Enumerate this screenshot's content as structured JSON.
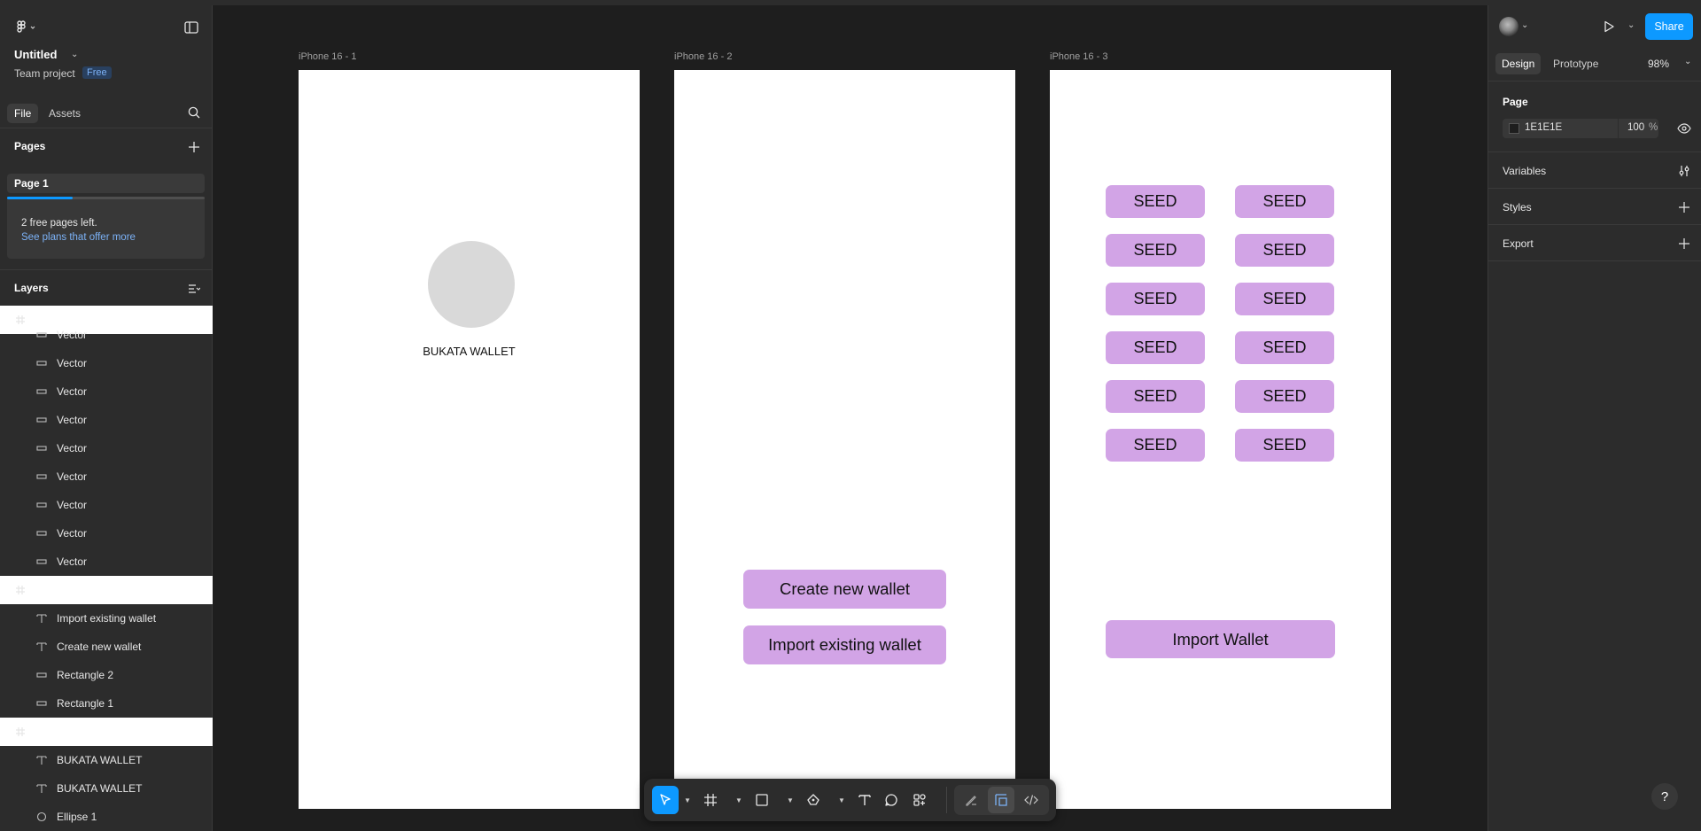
{
  "file": {
    "title": "Untitled",
    "project": "Team project",
    "plan_badge": "Free"
  },
  "left_tabs": {
    "file": "File",
    "assets": "Assets"
  },
  "pages": {
    "header": "Pages",
    "current": "Page 1"
  },
  "notice": {
    "line1": "2 free pages left.",
    "link": "See plans that offer more",
    "progress": 0.33
  },
  "layers": {
    "header": "Layers",
    "items": [
      {
        "name": "iPhone 16 - 3",
        "type": "frame"
      },
      {
        "name": "Vector",
        "type": "vector"
      },
      {
        "name": "Vector",
        "type": "vector"
      },
      {
        "name": "Vector",
        "type": "vector"
      },
      {
        "name": "Vector",
        "type": "vector"
      },
      {
        "name": "Vector",
        "type": "vector"
      },
      {
        "name": "Vector",
        "type": "vector"
      },
      {
        "name": "Vector",
        "type": "vector"
      },
      {
        "name": "Vector",
        "type": "vector"
      },
      {
        "name": "Vector",
        "type": "vector"
      },
      {
        "name": "iPhone 16 - 2",
        "type": "frame"
      },
      {
        "name": "Import existing wallet",
        "type": "text"
      },
      {
        "name": "Create new wallet",
        "type": "text"
      },
      {
        "name": "Rectangle 2",
        "type": "rect"
      },
      {
        "name": "Rectangle 1",
        "type": "rect"
      },
      {
        "name": "iPhone 16 - 1",
        "type": "frame"
      },
      {
        "name": "BUKATA WALLET",
        "type": "text"
      },
      {
        "name": "BUKATA WALLET",
        "type": "text"
      },
      {
        "name": "Ellipse 1",
        "type": "ellipse"
      }
    ]
  },
  "canvas": {
    "frames": [
      "iPhone 16 - 1",
      "iPhone 16 - 2",
      "iPhone 16 - 3"
    ],
    "frame1_text": "BUKATA WALLET",
    "frame2_buttons": [
      "Create new wallet",
      "Import existing wallet"
    ],
    "seed_label": "SEED",
    "import_button": "Import Wallet"
  },
  "right_panel": {
    "share": "Share",
    "tabs": {
      "design": "Design",
      "prototype": "Prototype"
    },
    "zoom": "98%",
    "page_section": "Page",
    "bg_color": "1E1E1E",
    "opacity": "100",
    "opacity_unit": "%",
    "variables": "Variables",
    "styles": "Styles",
    "export": "Export"
  },
  "colors": {
    "accent": "#0d99ff",
    "pill": "#d2a4e6",
    "canvas": "#1e1e1e",
    "panel": "#2c2c2c"
  }
}
